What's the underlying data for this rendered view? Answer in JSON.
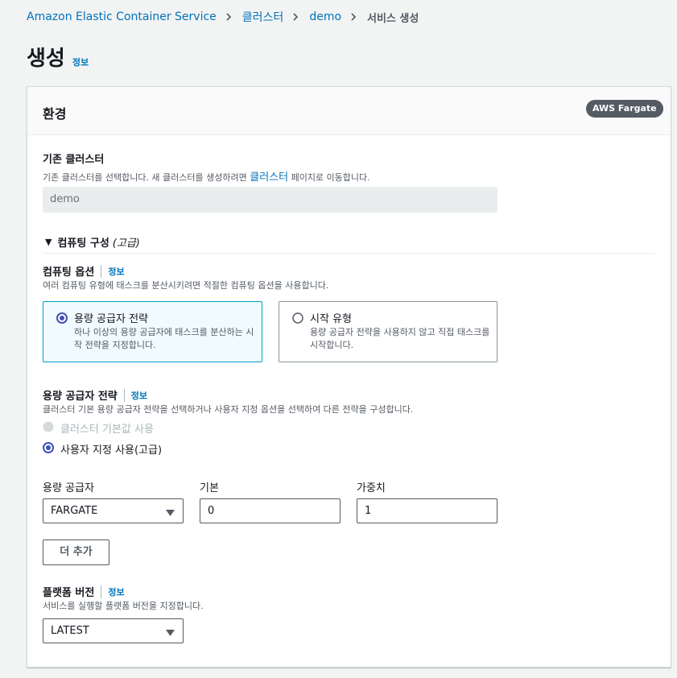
{
  "breadcrumb": {
    "items": [
      "Amazon Elastic Container Service",
      "클러스터",
      "demo"
    ],
    "current": "서비스 생성"
  },
  "page": {
    "title": "생성",
    "info": "정보"
  },
  "panel": {
    "title": "환경",
    "badge": "AWS Fargate"
  },
  "existing_cluster": {
    "label": "기존 클러스터",
    "desc_before": "기존 클러스터를 선택합니다. 새 클러스터를 생성하려면 ",
    "desc_link": "클러스터",
    "desc_after": " 페이지로 이동합니다.",
    "value": "demo"
  },
  "compute_config": {
    "heading": "컴퓨팅 구성",
    "heading_suffix": "(고급)"
  },
  "compute_options": {
    "label": "컴퓨팅 옵션",
    "info": "정보",
    "desc": "여러 컴퓨팅 유형에 태스크를 분산시키려면 적절한 컴퓨팅 옵션을 사용합니다.",
    "tiles": [
      {
        "label": "용량 공급자 전략",
        "desc": "하나 이상의 용량 공급자에 태스크를 분산하는 시작 전략을 지정합니다.",
        "selected": true
      },
      {
        "label": "시작 유형",
        "desc": "용량 공급자 전략을 사용하지 않고 직접 태스크를 시작합니다.",
        "selected": false
      }
    ]
  },
  "capacity_strategy": {
    "label": "용량 공급자 전략",
    "info": "정보",
    "desc": "클러스터 기본 용량 공급자 전략을 선택하거나 사용자 지정 옵션을 선택하여 다른 전략을 구성합니다.",
    "options": [
      {
        "label": "클러스터 기본값 사용",
        "disabled": true,
        "selected": false
      },
      {
        "label": "사용자 지정 사용(고급)",
        "disabled": false,
        "selected": true
      }
    ]
  },
  "provider_table": {
    "provider_label": "용량 공급자",
    "base_label": "기본",
    "weight_label": "가중치",
    "provider_value": "FARGATE",
    "base_value": "0",
    "weight_value": "1"
  },
  "add_more_button": "더 추가",
  "platform_version": {
    "label": "플랫폼 버전",
    "info": "정보",
    "desc": "서비스를 실행할 플랫폼 버전을 지정합니다.",
    "value": "LATEST"
  },
  "colors": {
    "link": "#0073bb",
    "radio_selected": "#3f51b5",
    "badge_bg": "#545b64",
    "tile_selected_bg": "#f1faff"
  }
}
